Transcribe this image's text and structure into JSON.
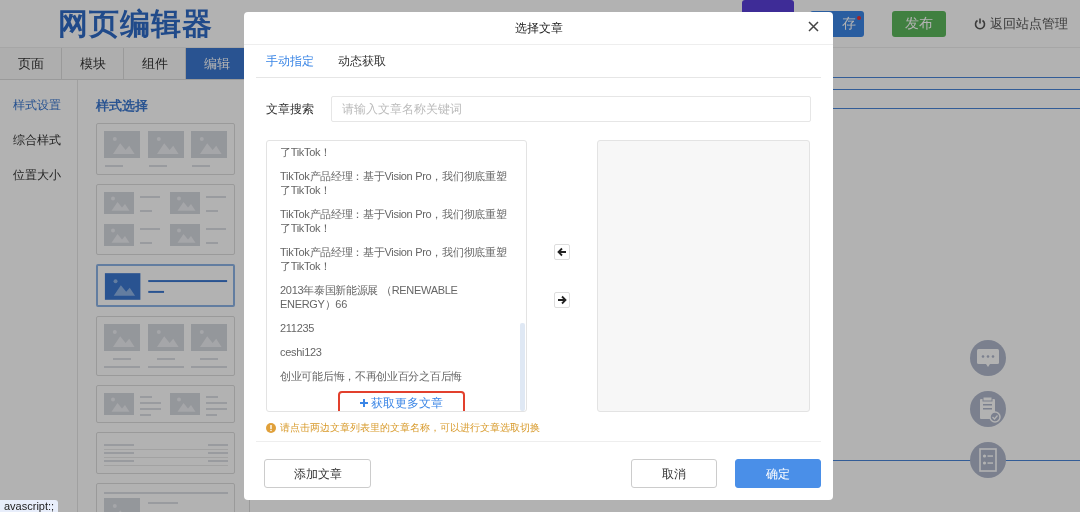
{
  "header": {
    "logo": "网页编辑器",
    "save_button": {
      "label": "存",
      "unsaved": true
    },
    "publish_button": "发布",
    "exit_link": "返回站点管理"
  },
  "panel_tabs": [
    {
      "label": "页面",
      "selected": false
    },
    {
      "label": "模块",
      "selected": false
    },
    {
      "label": "组件",
      "selected": false
    },
    {
      "label": "编辑",
      "selected": true
    }
  ],
  "settings_menu": [
    {
      "label": "样式设置",
      "selected": true
    },
    {
      "label": "综合样式",
      "selected": false
    },
    {
      "label": "位置大小",
      "selected": false
    }
  ],
  "style_panel": {
    "title": "样式选择",
    "styles": [
      {
        "kind": "three-up",
        "selected": false
      },
      {
        "kind": "two-by-two",
        "selected": false
      },
      {
        "kind": "left-image",
        "selected": true
      },
      {
        "kind": "three-up-caption",
        "selected": false
      },
      {
        "kind": "image-pair",
        "selected": false
      },
      {
        "kind": "text-rows",
        "selected": false
      },
      {
        "kind": "partial",
        "selected": false
      }
    ]
  },
  "status_tip": "avascript:;",
  "dialog": {
    "title": "选择文章",
    "tabs": [
      {
        "label": "手动指定",
        "selected": true
      },
      {
        "label": "动态获取",
        "selected": false
      }
    ],
    "search": {
      "label": "文章搜索",
      "placeholder": "请输入文章名称关键词"
    },
    "articles": [
      {
        "title": "了TikTok！"
      },
      {
        "title": "TikTok产品经理：基于Vision Pro，我们彻底重塑了TikTok！"
      },
      {
        "title": "TikTok产品经理：基于Vision Pro，我们彻底重塑了TikTok！"
      },
      {
        "title": "TikTok产品经理：基于Vision Pro，我们彻底重塑了TikTok！"
      },
      {
        "title": "2013年泰国新能源展 （RENEWABLE ENERGY）66"
      },
      {
        "title": "211235"
      },
      {
        "title": "ceshi123"
      },
      {
        "title": "创业可能后悔，不再创业百分之百后悔"
      }
    ],
    "load_more": "获取更多文章",
    "hint": "请点击两边文章列表里的文章名称，可以进行文章选取切换",
    "add_button": "添加文章",
    "cancel_button": "取消",
    "confirm_button": "确定"
  }
}
